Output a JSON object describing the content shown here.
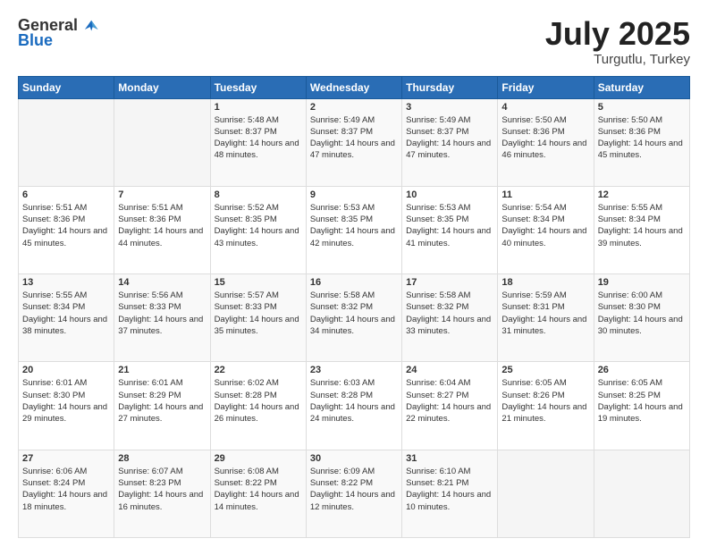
{
  "logo": {
    "general": "General",
    "blue": "Blue"
  },
  "title": {
    "month": "July 2025",
    "location": "Turgutlu, Turkey"
  },
  "weekdays": [
    "Sunday",
    "Monday",
    "Tuesday",
    "Wednesday",
    "Thursday",
    "Friday",
    "Saturday"
  ],
  "weeks": [
    [
      {
        "day": "",
        "detail": ""
      },
      {
        "day": "",
        "detail": ""
      },
      {
        "day": "1",
        "detail": "Sunrise: 5:48 AM\nSunset: 8:37 PM\nDaylight: 14 hours and 48 minutes."
      },
      {
        "day": "2",
        "detail": "Sunrise: 5:49 AM\nSunset: 8:37 PM\nDaylight: 14 hours and 47 minutes."
      },
      {
        "day": "3",
        "detail": "Sunrise: 5:49 AM\nSunset: 8:37 PM\nDaylight: 14 hours and 47 minutes."
      },
      {
        "day": "4",
        "detail": "Sunrise: 5:50 AM\nSunset: 8:36 PM\nDaylight: 14 hours and 46 minutes."
      },
      {
        "day": "5",
        "detail": "Sunrise: 5:50 AM\nSunset: 8:36 PM\nDaylight: 14 hours and 45 minutes."
      }
    ],
    [
      {
        "day": "6",
        "detail": "Sunrise: 5:51 AM\nSunset: 8:36 PM\nDaylight: 14 hours and 45 minutes."
      },
      {
        "day": "7",
        "detail": "Sunrise: 5:51 AM\nSunset: 8:36 PM\nDaylight: 14 hours and 44 minutes."
      },
      {
        "day": "8",
        "detail": "Sunrise: 5:52 AM\nSunset: 8:35 PM\nDaylight: 14 hours and 43 minutes."
      },
      {
        "day": "9",
        "detail": "Sunrise: 5:53 AM\nSunset: 8:35 PM\nDaylight: 14 hours and 42 minutes."
      },
      {
        "day": "10",
        "detail": "Sunrise: 5:53 AM\nSunset: 8:35 PM\nDaylight: 14 hours and 41 minutes."
      },
      {
        "day": "11",
        "detail": "Sunrise: 5:54 AM\nSunset: 8:34 PM\nDaylight: 14 hours and 40 minutes."
      },
      {
        "day": "12",
        "detail": "Sunrise: 5:55 AM\nSunset: 8:34 PM\nDaylight: 14 hours and 39 minutes."
      }
    ],
    [
      {
        "day": "13",
        "detail": "Sunrise: 5:55 AM\nSunset: 8:34 PM\nDaylight: 14 hours and 38 minutes."
      },
      {
        "day": "14",
        "detail": "Sunrise: 5:56 AM\nSunset: 8:33 PM\nDaylight: 14 hours and 37 minutes."
      },
      {
        "day": "15",
        "detail": "Sunrise: 5:57 AM\nSunset: 8:33 PM\nDaylight: 14 hours and 35 minutes."
      },
      {
        "day": "16",
        "detail": "Sunrise: 5:58 AM\nSunset: 8:32 PM\nDaylight: 14 hours and 34 minutes."
      },
      {
        "day": "17",
        "detail": "Sunrise: 5:58 AM\nSunset: 8:32 PM\nDaylight: 14 hours and 33 minutes."
      },
      {
        "day": "18",
        "detail": "Sunrise: 5:59 AM\nSunset: 8:31 PM\nDaylight: 14 hours and 31 minutes."
      },
      {
        "day": "19",
        "detail": "Sunrise: 6:00 AM\nSunset: 8:30 PM\nDaylight: 14 hours and 30 minutes."
      }
    ],
    [
      {
        "day": "20",
        "detail": "Sunrise: 6:01 AM\nSunset: 8:30 PM\nDaylight: 14 hours and 29 minutes."
      },
      {
        "day": "21",
        "detail": "Sunrise: 6:01 AM\nSunset: 8:29 PM\nDaylight: 14 hours and 27 minutes."
      },
      {
        "day": "22",
        "detail": "Sunrise: 6:02 AM\nSunset: 8:28 PM\nDaylight: 14 hours and 26 minutes."
      },
      {
        "day": "23",
        "detail": "Sunrise: 6:03 AM\nSunset: 8:28 PM\nDaylight: 14 hours and 24 minutes."
      },
      {
        "day": "24",
        "detail": "Sunrise: 6:04 AM\nSunset: 8:27 PM\nDaylight: 14 hours and 22 minutes."
      },
      {
        "day": "25",
        "detail": "Sunrise: 6:05 AM\nSunset: 8:26 PM\nDaylight: 14 hours and 21 minutes."
      },
      {
        "day": "26",
        "detail": "Sunrise: 6:05 AM\nSunset: 8:25 PM\nDaylight: 14 hours and 19 minutes."
      }
    ],
    [
      {
        "day": "27",
        "detail": "Sunrise: 6:06 AM\nSunset: 8:24 PM\nDaylight: 14 hours and 18 minutes."
      },
      {
        "day": "28",
        "detail": "Sunrise: 6:07 AM\nSunset: 8:23 PM\nDaylight: 14 hours and 16 minutes."
      },
      {
        "day": "29",
        "detail": "Sunrise: 6:08 AM\nSunset: 8:22 PM\nDaylight: 14 hours and 14 minutes."
      },
      {
        "day": "30",
        "detail": "Sunrise: 6:09 AM\nSunset: 8:22 PM\nDaylight: 14 hours and 12 minutes."
      },
      {
        "day": "31",
        "detail": "Sunrise: 6:10 AM\nSunset: 8:21 PM\nDaylight: 14 hours and 10 minutes."
      },
      {
        "day": "",
        "detail": ""
      },
      {
        "day": "",
        "detail": ""
      }
    ]
  ]
}
